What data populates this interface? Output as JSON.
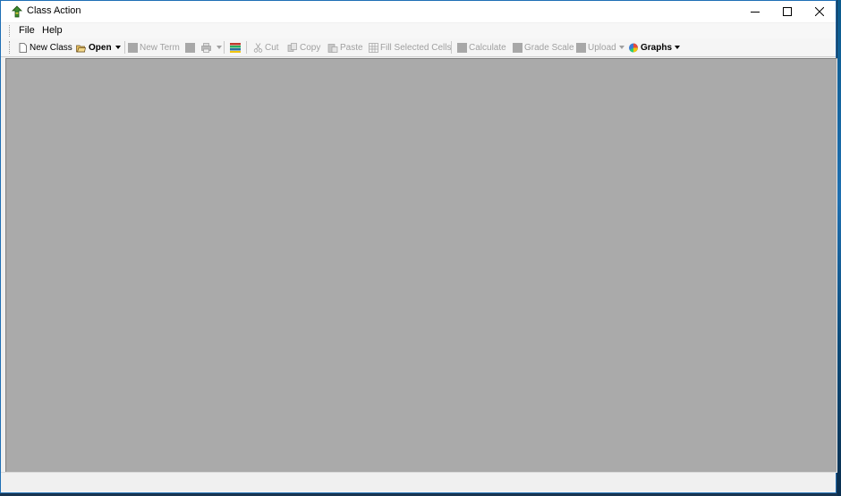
{
  "window": {
    "title": "Class Action"
  },
  "controls": {
    "minimize": "—",
    "maximize": "☐",
    "close": "✕"
  },
  "menu": {
    "file": "File",
    "help": "Help"
  },
  "toolbar": {
    "new_class": "New Class",
    "open": "Open",
    "new_term": "New Term",
    "cut": "Cut",
    "copy": "Copy",
    "paste": "Paste",
    "fill_selected_cells": "Fill Selected Cells",
    "calculate": "Calculate",
    "grade_scale": "Grade Scale",
    "upload": "Upload",
    "graphs": "Graphs"
  },
  "status": {
    "text": ""
  },
  "colors": {
    "workspace": "#aaaaaa",
    "accent": "#1f6fb5"
  }
}
